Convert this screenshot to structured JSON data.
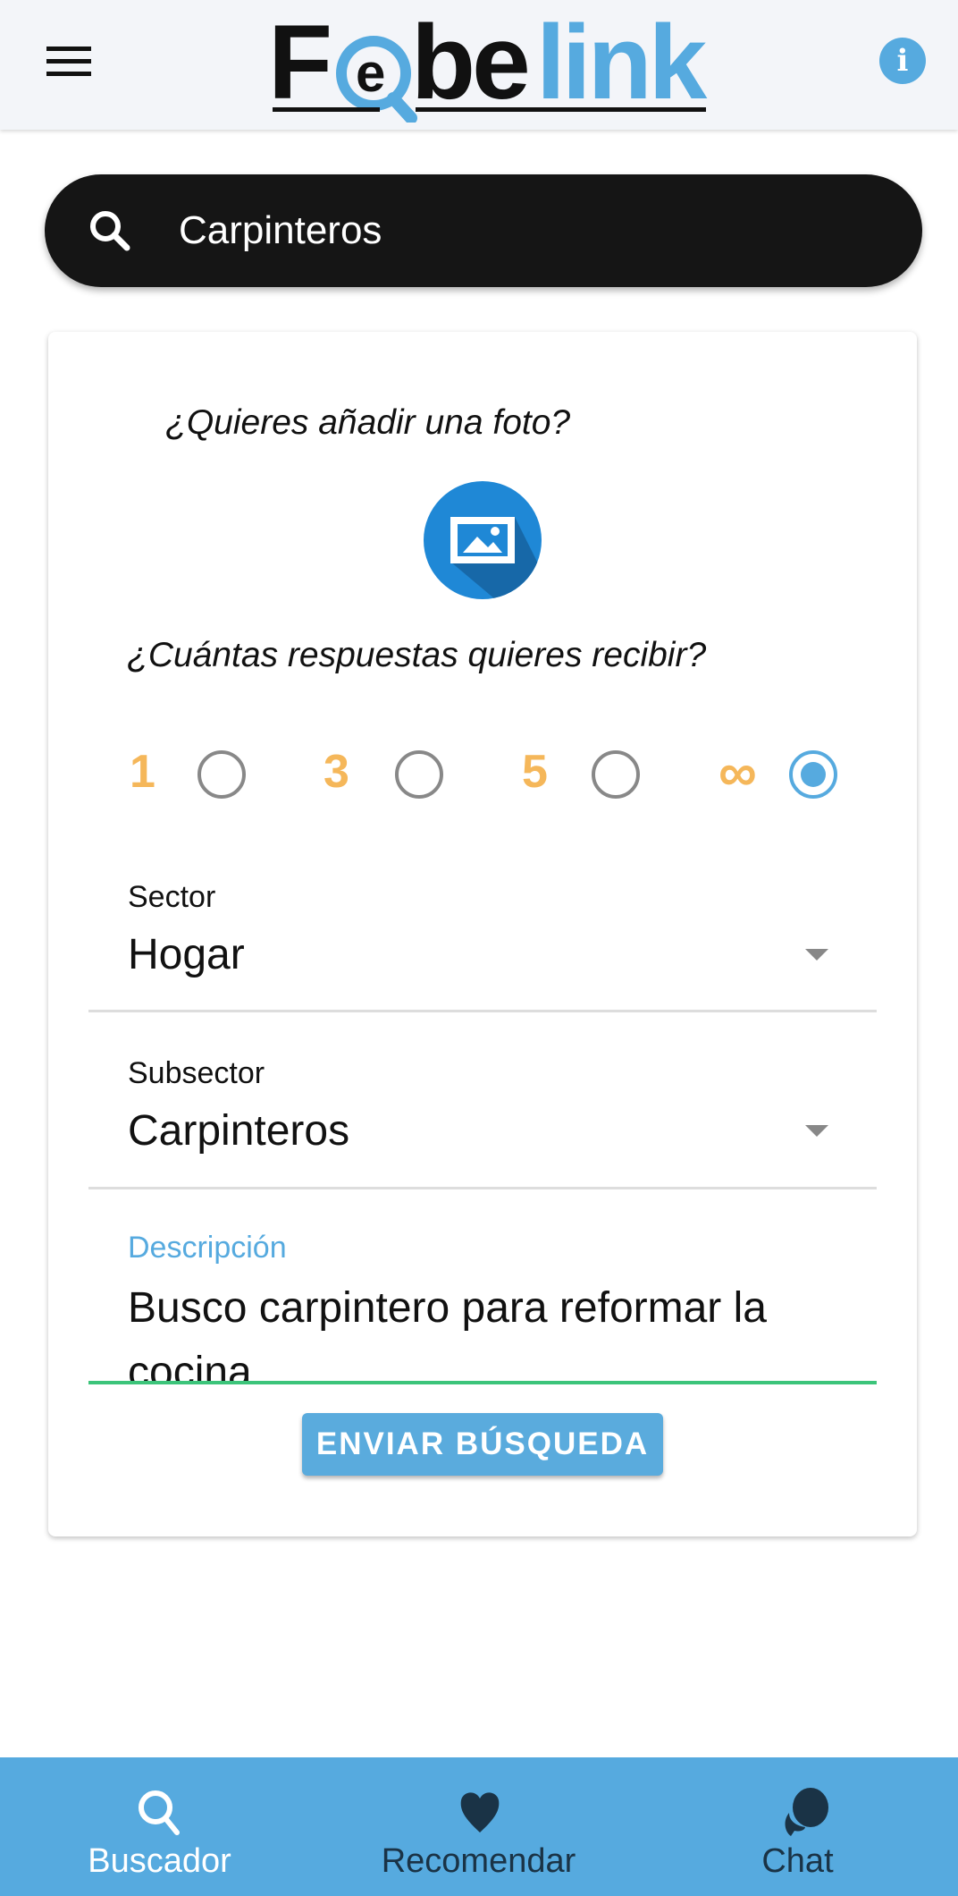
{
  "header": {
    "logo_text": "Febelink",
    "menu_icon": "hamburger-icon",
    "info_icon": "info-icon"
  },
  "search": {
    "value": "Carpinteros",
    "icon": "search-icon"
  },
  "form": {
    "photo_question": "¿Quieres añadir una foto?",
    "photo_icon": "image-icon",
    "responses_question": "¿Cuántas respuestas quieres recibir?",
    "response_options": [
      {
        "label": "1",
        "selected": false
      },
      {
        "label": "3",
        "selected": false
      },
      {
        "label": "5",
        "selected": false
      },
      {
        "label": "∞",
        "selected": true
      }
    ],
    "sector": {
      "label": "Sector",
      "value": "Hogar"
    },
    "subsector": {
      "label": "Subsector",
      "value": "Carpinteros"
    },
    "description": {
      "label": "Descripción",
      "value": "Busco carpintero para reformar la cocina."
    },
    "submit_label": "ENVIAR BÚSQUEDA"
  },
  "nav": {
    "items": [
      {
        "label": "Buscador",
        "icon": "search-icon",
        "active": true
      },
      {
        "label": "Recomendar",
        "icon": "heart-icon",
        "active": false
      },
      {
        "label": "Chat",
        "icon": "chat-icon",
        "active": false
      }
    ]
  },
  "colors": {
    "accent": "#56aadf",
    "number": "#f5b75a",
    "focus_line": "#3cc47a",
    "nav_inactive": "#1a3346"
  }
}
